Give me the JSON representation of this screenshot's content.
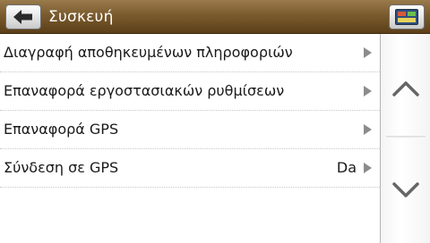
{
  "header": {
    "title": "Συσκευή",
    "back_icon": "arrow-left-icon",
    "map_icon": "map-icon",
    "accent_color": "#7a5b2e"
  },
  "menu": {
    "items": [
      {
        "label": "Διαγραφή αποθηκευμένων πληροφοριών",
        "value": ""
      },
      {
        "label": "Επαναφορά εργοστασιακών ρυθμίσεων",
        "value": ""
      },
      {
        "label": "Επαναφορά GPS",
        "value": ""
      },
      {
        "label": "Σύνδεση σε GPS",
        "value": "Da"
      }
    ]
  },
  "scrollbar": {
    "up_icon": "chevron-up-icon",
    "down_icon": "chevron-down-icon"
  }
}
